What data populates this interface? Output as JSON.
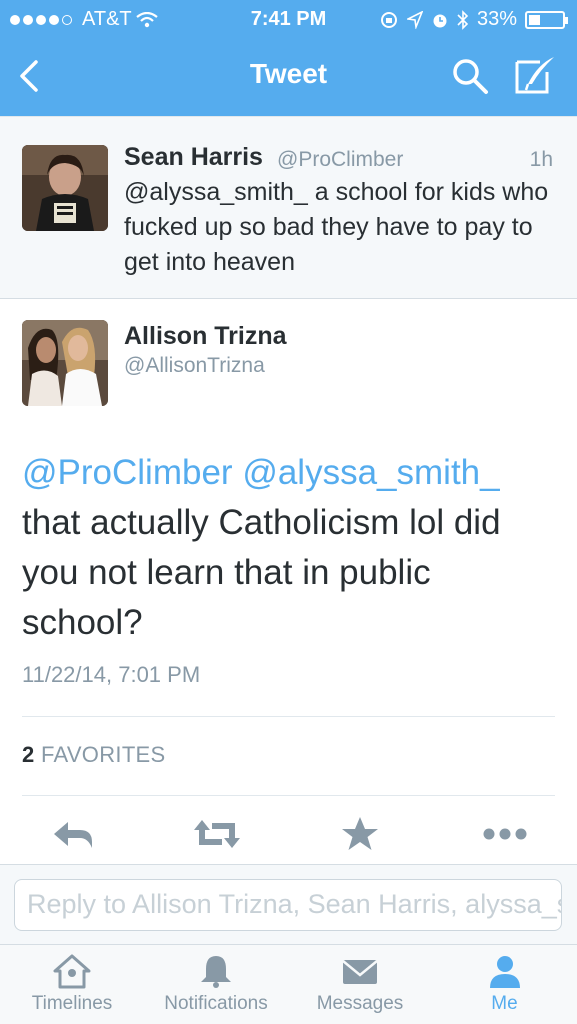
{
  "status_bar": {
    "carrier": "AT&T",
    "time": "7:41 PM",
    "battery": "33%",
    "battery_level": 0.33,
    "signal_bars": 4
  },
  "nav": {
    "title": "Tweet",
    "icons": [
      "back-chevron-icon",
      "search-icon",
      "compose-icon"
    ]
  },
  "parent_tweet": {
    "name": "Sean Harris",
    "handle": "@ProClimber",
    "age": "1h",
    "text": "@alyssa_smith_ a school for kids who fucked up so bad they have to pay to get into heaven"
  },
  "tweet": {
    "name": "Allison Trizna",
    "handle": "@AllisonTrizna",
    "mention_1": "@ProClimber",
    "mention_2": "@alyssa_smith_",
    "body": "that actually Catholicism lol did you not learn that in public school?",
    "timestamp": "11/22/14, 7:01 PM",
    "favorites_count": "2",
    "favorites_label": "FAVORITES"
  },
  "actions": [
    "reply-icon",
    "retweet-icon",
    "favorite-icon",
    "more-icon"
  ],
  "reply": {
    "placeholder": "Reply to Allison Trizna, Sean Harris, alyssa_smith_"
  },
  "tabs": [
    {
      "label": "Timelines",
      "icon": "home-icon"
    },
    {
      "label": "Notifications",
      "icon": "bell-icon"
    },
    {
      "label": "Messages",
      "icon": "envelope-icon"
    },
    {
      "label": "Me",
      "icon": "person-icon",
      "active": true
    }
  ],
  "colors": {
    "brand": "#55acee",
    "muted": "#8899a6",
    "text": "#292f33"
  }
}
